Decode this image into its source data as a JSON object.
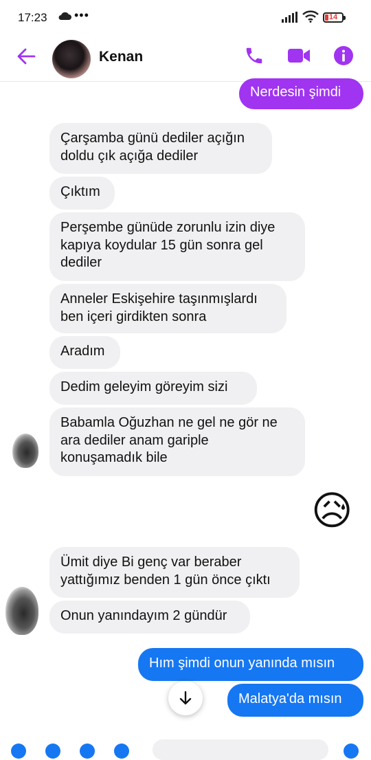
{
  "status_bar": {
    "time": "17:23",
    "dots": "•••",
    "battery": "14"
  },
  "header": {
    "contact_name": "Kenan",
    "icons": [
      "back-arrow-icon",
      "phone-icon",
      "video-camera-icon",
      "info-icon"
    ],
    "accent_color": "#a034f0"
  },
  "messages": [
    {
      "side": "out",
      "text": "Nerdesin şimdi"
    },
    {
      "side": "in",
      "text": "Çarşamba günü dediler açığın\ndoldu çık açığa dediler"
    },
    {
      "side": "in",
      "text": "Çıktım"
    },
    {
      "side": "in",
      "text": "Perşembe günüde zorunlu izin diye\nkapıya koydular 15 gün sonra gel\ndediler"
    },
    {
      "side": "in",
      "text": "Anneler Eskişehire taşınmışlardı\nben içeri girdikten sonra"
    },
    {
      "side": "in",
      "text": "Aradım"
    },
    {
      "side": "in",
      "text": "Dedim geleyim göreyim sizi"
    },
    {
      "side": "in",
      "text": "Babamla Oğuzhan ne gel ne gör ne\nara dediler anam gariple\nkonuşamadık bile"
    },
    {
      "side": "out",
      "text": "😥"
    },
    {
      "side": "in",
      "text": "Ümit diye Bi genç var beraber\nyattığımız benden 1 gün önce çıktı"
    },
    {
      "side": "in",
      "text": "Onun yanındayım 2 gündür"
    },
    {
      "side": "out",
      "text": "Hım şimdi onun yanında mısın"
    },
    {
      "side": "out",
      "text": "Malatya'da mısın"
    }
  ],
  "colors": {
    "outgoing_purple": "#a034f0",
    "outgoing_blue": "#1677f2",
    "incoming_gray": "#f0f0f2"
  }
}
